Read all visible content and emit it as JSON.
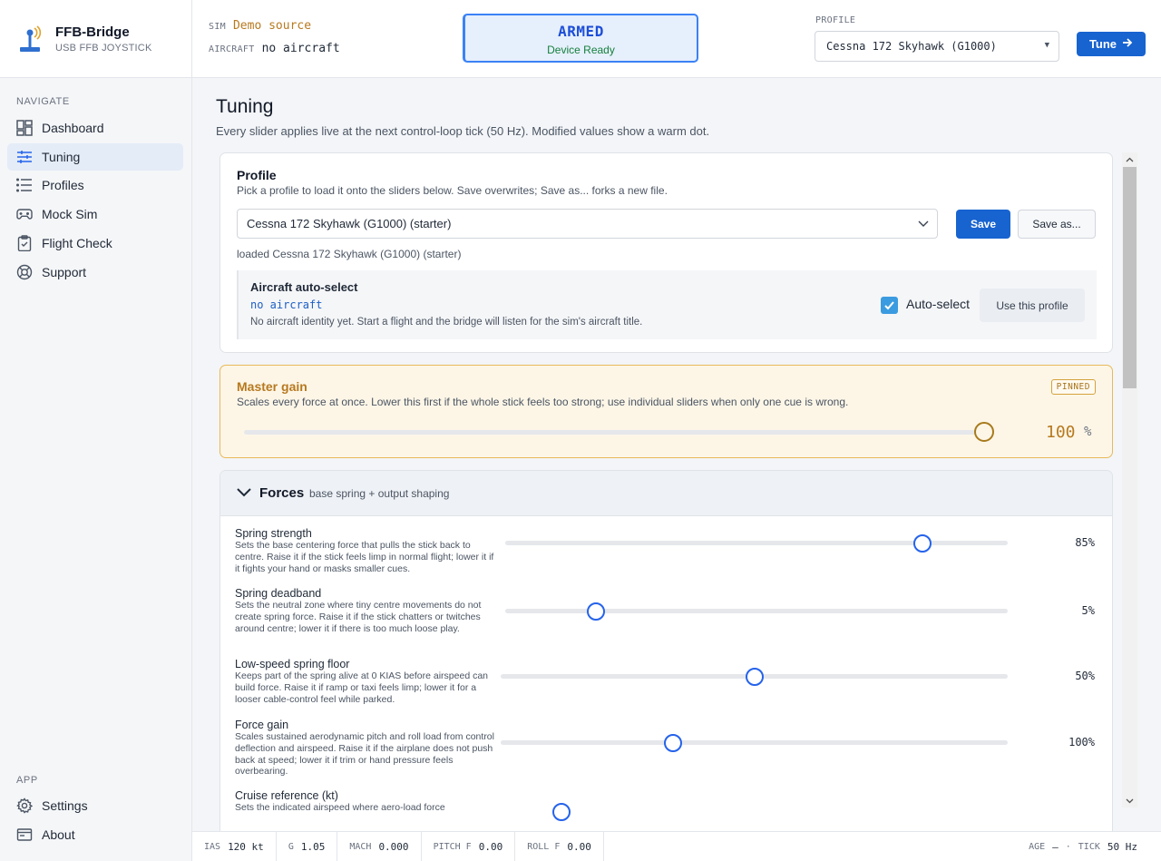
{
  "brand": {
    "title": "FFB-Bridge",
    "subtitle": "USB FFB JOYSTICK"
  },
  "sidebar": {
    "navigate_heading": "NAVIGATE",
    "nav": [
      {
        "label": "Dashboard",
        "icon": "dashboard-icon"
      },
      {
        "label": "Tuning",
        "icon": "sliders-icon",
        "active": true
      },
      {
        "label": "Profiles",
        "icon": "list-icon"
      },
      {
        "label": "Mock Sim",
        "icon": "gamepad-icon"
      },
      {
        "label": "Flight Check",
        "icon": "clipboard-check-icon"
      },
      {
        "label": "Support",
        "icon": "lifebuoy-icon"
      }
    ],
    "app_heading": "APP",
    "app": [
      {
        "label": "Settings",
        "icon": "gear-icon"
      },
      {
        "label": "About",
        "icon": "window-icon"
      }
    ]
  },
  "header": {
    "sim_label": "SIM",
    "sim_value": "Demo source",
    "aircraft_label": "AIRCRAFT",
    "aircraft_value": "no aircraft",
    "armed_title": "ARMED",
    "armed_sub": "Device Ready",
    "profile_label": "PROFILE",
    "profile_value": "Cessna 172 Skyhawk (G1000)",
    "tune_button": "Tune"
  },
  "page": {
    "title": "Tuning",
    "subtitle": "Every slider applies live at the next control-loop tick (50 Hz). Modified values show a warm dot."
  },
  "profile_card": {
    "title": "Profile",
    "description": "Pick a profile to load it onto the sliders below. Save overwrites; Save as... forks a new file.",
    "selected": "Cessna 172 Skyhawk (G1000) (starter)",
    "save_button": "Save",
    "save_as_button": "Save as...",
    "loaded_text": "loaded Cessna 172 Skyhawk (G1000) (starter)",
    "auto_select": {
      "title": "Aircraft auto-select",
      "aircraft": "no aircraft",
      "description": "No aircraft identity yet. Start a flight and the bridge will listen for the sim's aircraft title.",
      "checkbox_label": "Auto-select",
      "checked": true,
      "use_button": "Use this profile"
    }
  },
  "master_gain": {
    "title": "Master gain",
    "description": "Scales every force at once. Lower this first if the whole stick feels too strong; use individual sliders when only one cue is wrong.",
    "badge": "PINNED",
    "value": "100",
    "unit": "%",
    "fraction": 1.0
  },
  "forces": {
    "title": "Forces",
    "subtitle": "base spring + output shaping",
    "sliders": [
      {
        "name": "Spring strength",
        "description": "Sets the base centering force that pulls the stick back to centre. Raise it if the stick feels limp in normal flight; lower it if it fights your hand or masks smaller cues.",
        "value": "85%",
        "fraction": 0.83
      },
      {
        "name": "Spring deadband",
        "description": "Sets the neutral zone where tiny centre movements do not create spring force. Raise it if the stick chatters or twitches around centre; lower it if there is too much loose play.",
        "value": "5%",
        "fraction": 0.18
      },
      {
        "name": "Low-speed spring floor",
        "description": "Keeps part of the spring alive at 0 KIAS before airspeed can build force. Raise it if ramp or taxi feels limp; lower it for a looser cable-control feel while parked.",
        "value": "50%",
        "fraction": 0.5
      },
      {
        "name": "Force gain",
        "description": "Scales sustained aerodynamic pitch and roll load from control deflection and airspeed. Raise it if the airplane does not push back at speed; lower it if trim or hand pressure feels overbearing.",
        "value": "100%",
        "fraction": 0.34
      },
      {
        "name": "Cruise reference (kt)",
        "description": "Sets the indicated airspeed where aero-load force",
        "value": "",
        "fraction": 0.12
      }
    ]
  },
  "statusbar": {
    "items": [
      {
        "key": "IAS",
        "value": "120 kt"
      },
      {
        "key": "G",
        "value": "1.05"
      },
      {
        "key": "MACH",
        "value": "0.000"
      },
      {
        "key": "PITCH F",
        "value": "0.00"
      },
      {
        "key": "ROLL F",
        "value": "0.00"
      }
    ],
    "age_label": "AGE",
    "age_value": "—",
    "separator": "·",
    "tick_label": "TICK",
    "tick_value": "50 Hz"
  },
  "colors": {
    "accent": "#1763d0",
    "armed_bg": "#e6effc",
    "warm": "#b7791f",
    "ready_green": "#15803d"
  }
}
